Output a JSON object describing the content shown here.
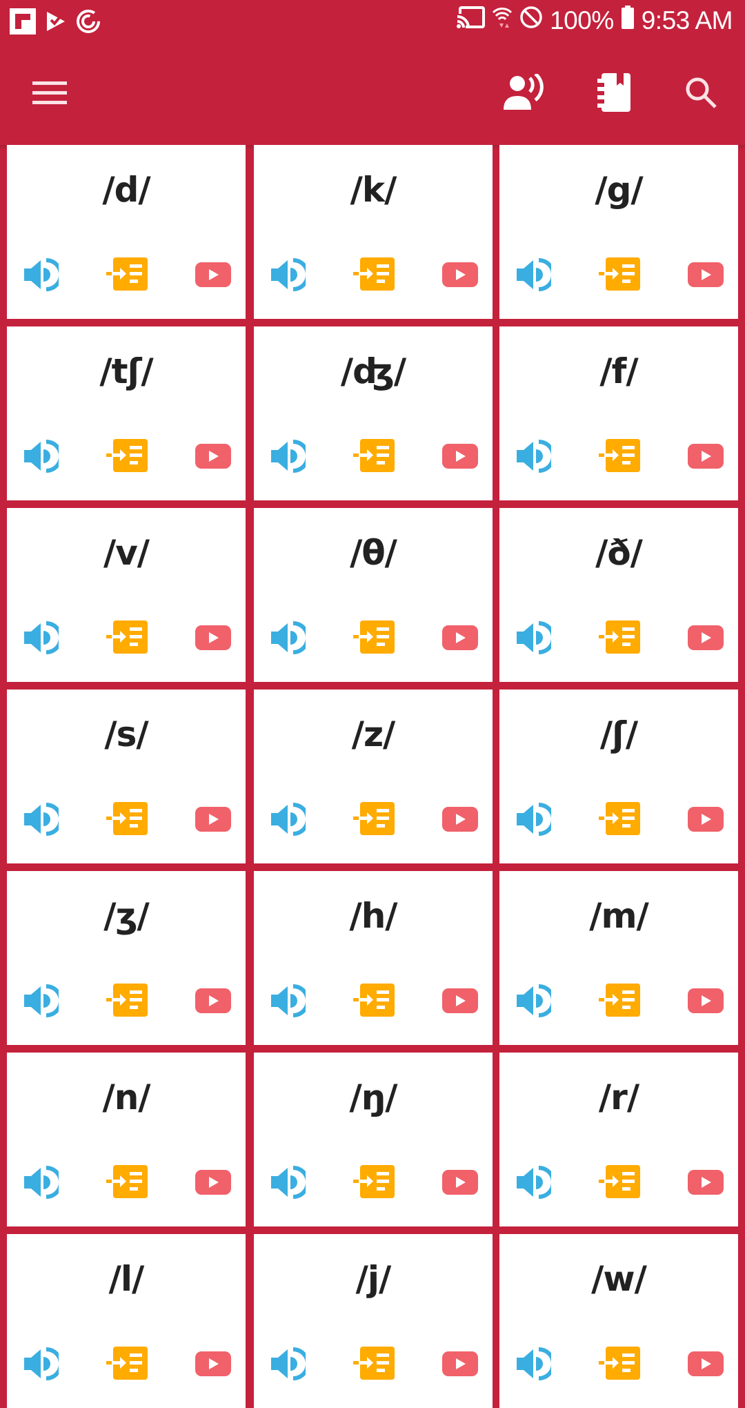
{
  "status_bar": {
    "left_icons": [
      "flipboard-icon",
      "tasks-icon",
      "sync-icon"
    ],
    "right_icons": [
      "cast-icon",
      "wifi-icon",
      "do-not-disturb-icon",
      "battery-icon"
    ],
    "battery": "100%",
    "time": "9:53 AM"
  },
  "app_bar": {
    "menu_icon": "hamburger-menu-icon",
    "actions": [
      "voice-speaker-icon",
      "notebook-icon",
      "search-icon"
    ]
  },
  "colors": {
    "primary": "#c4213c",
    "speaker": "#3aaee0",
    "list": "#ffab00",
    "youtube": "#f0616a"
  },
  "sounds": [
    {
      "symbol": "/d/"
    },
    {
      "symbol": "/k/"
    },
    {
      "symbol": "/g/"
    },
    {
      "symbol": "/tʃ/"
    },
    {
      "symbol": "/ʤ/"
    },
    {
      "symbol": "/f/"
    },
    {
      "symbol": "/v/"
    },
    {
      "symbol": "/θ/"
    },
    {
      "symbol": "/ð/"
    },
    {
      "symbol": "/s/"
    },
    {
      "symbol": "/z/"
    },
    {
      "symbol": "/ʃ/"
    },
    {
      "symbol": "/ʒ/"
    },
    {
      "symbol": "/h/"
    },
    {
      "symbol": "/m/"
    },
    {
      "symbol": "/n/"
    },
    {
      "symbol": "/ŋ/"
    },
    {
      "symbol": "/r/"
    },
    {
      "symbol": "/l/"
    },
    {
      "symbol": "/j/"
    },
    {
      "symbol": "/w/"
    }
  ],
  "card_actions": [
    "play-audio",
    "examples-list",
    "youtube-video"
  ]
}
